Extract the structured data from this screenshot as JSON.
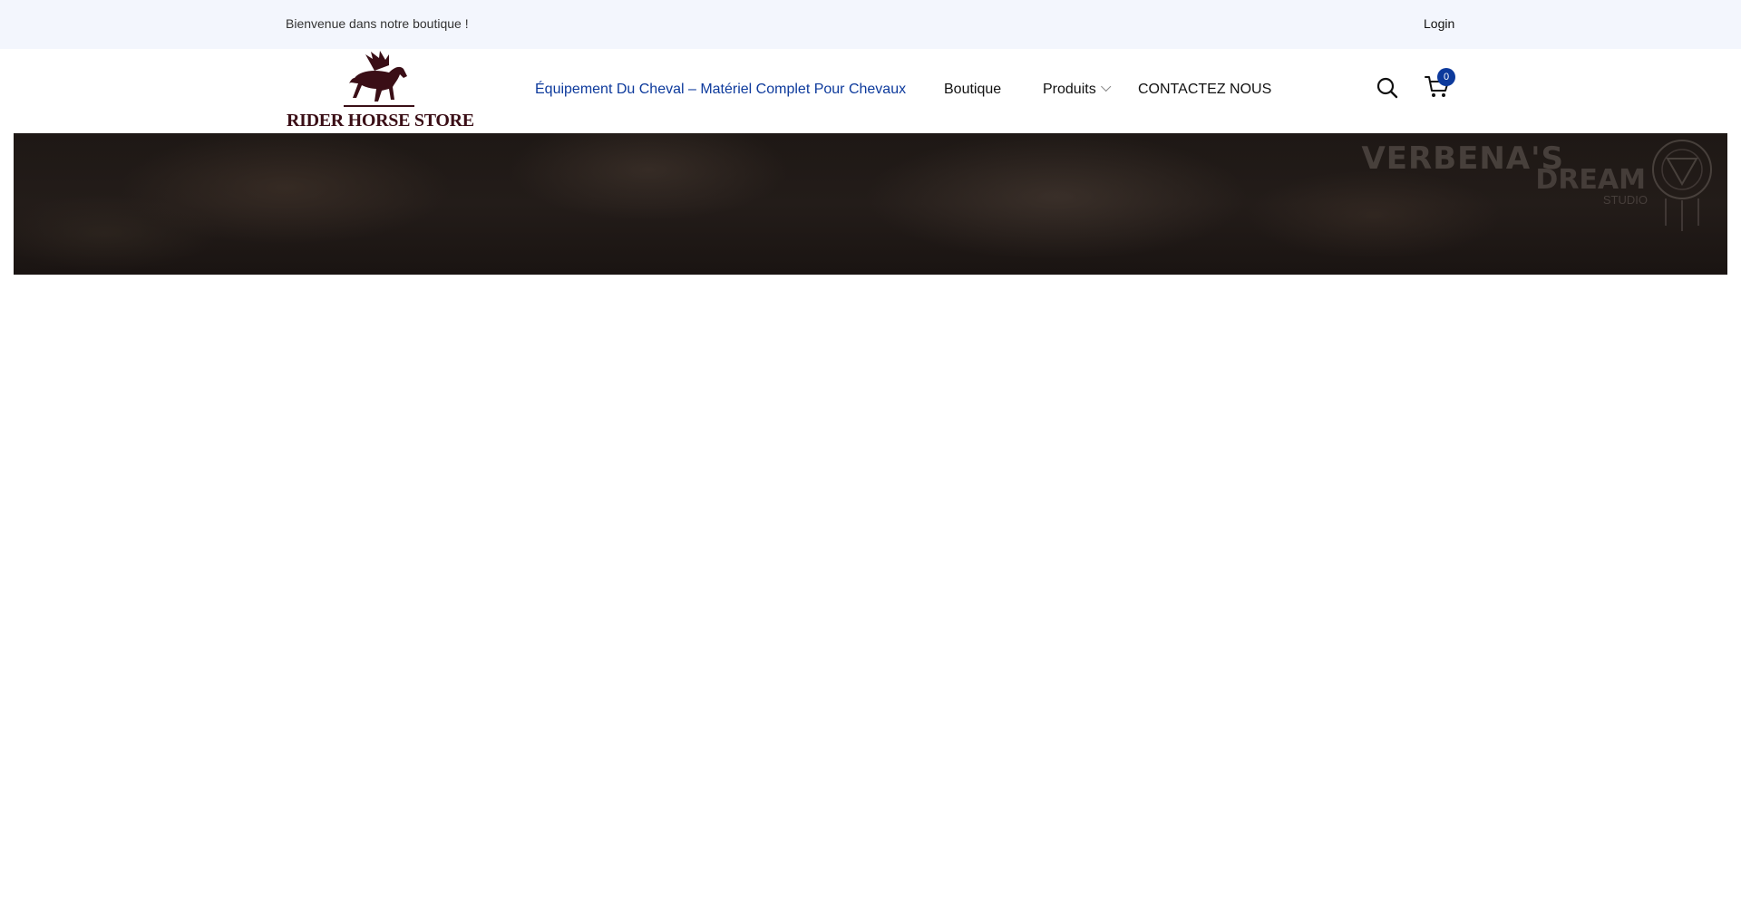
{
  "topbar": {
    "welcome_text": "Bienvenue dans notre boutique !",
    "login_label": "Login"
  },
  "logo": {
    "text": "RIDER HORSE STORE",
    "icon": "winged-horse-icon",
    "color": "#3a0e16"
  },
  "nav": {
    "items": [
      {
        "label": "Équipement Du Cheval – Matériel Complet Pour Chevaux",
        "active": true
      },
      {
        "label": "Boutique"
      },
      {
        "label": "Produits",
        "has_dropdown": true
      },
      {
        "label": "CONTACTEZ NOUS"
      }
    ]
  },
  "header_actions": {
    "search_icon": "search-icon",
    "cart_icon": "cart-icon",
    "cart_count": "0"
  },
  "banner": {
    "watermark_line1": "VERBENA'S",
    "watermark_line2": "DREAM",
    "watermark_line3": "STUDIO"
  },
  "colors": {
    "accent": "#0d3a9c",
    "topbar_bg": "#f3f6fd",
    "banner_bg": "#1e1815"
  }
}
